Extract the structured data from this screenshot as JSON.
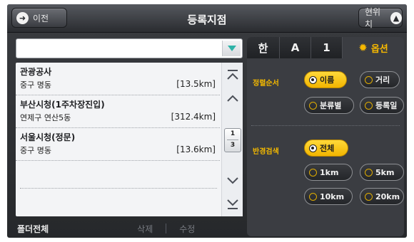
{
  "header": {
    "back_label": "이전",
    "title": "등록지점",
    "location_label": "현위치"
  },
  "search": {
    "value": ""
  },
  "list": {
    "items": [
      {
        "name": "관광공사",
        "address": "중구 명동",
        "distance": "[13.5km]"
      },
      {
        "name": "부산시청(1주차장진입)",
        "address": "연제구 연산5동",
        "distance": "[312.4km]"
      },
      {
        "name": "서울시청(정문)",
        "address": "중구 명동",
        "distance": "[13.6km]"
      }
    ],
    "page_current": "1",
    "page_total": "3"
  },
  "bottom": {
    "folder_all": "폴더전체",
    "delete": "삭제",
    "edit": "수정"
  },
  "tabs": {
    "hangul": "한",
    "alpha": "A",
    "number": "1",
    "options": "옵션"
  },
  "options": {
    "sort_label": "정렬순서",
    "sort_items": [
      "이름",
      "거리",
      "분류별",
      "등록일"
    ],
    "sort_selected": "이름",
    "radius_label": "반경검색",
    "radius_items": [
      "전체",
      "1km",
      "5km",
      "10km",
      "20km"
    ],
    "radius_selected": "전체"
  },
  "colors": {
    "accent": "#f6b800",
    "search_dropdown": "#2fb3a8"
  }
}
